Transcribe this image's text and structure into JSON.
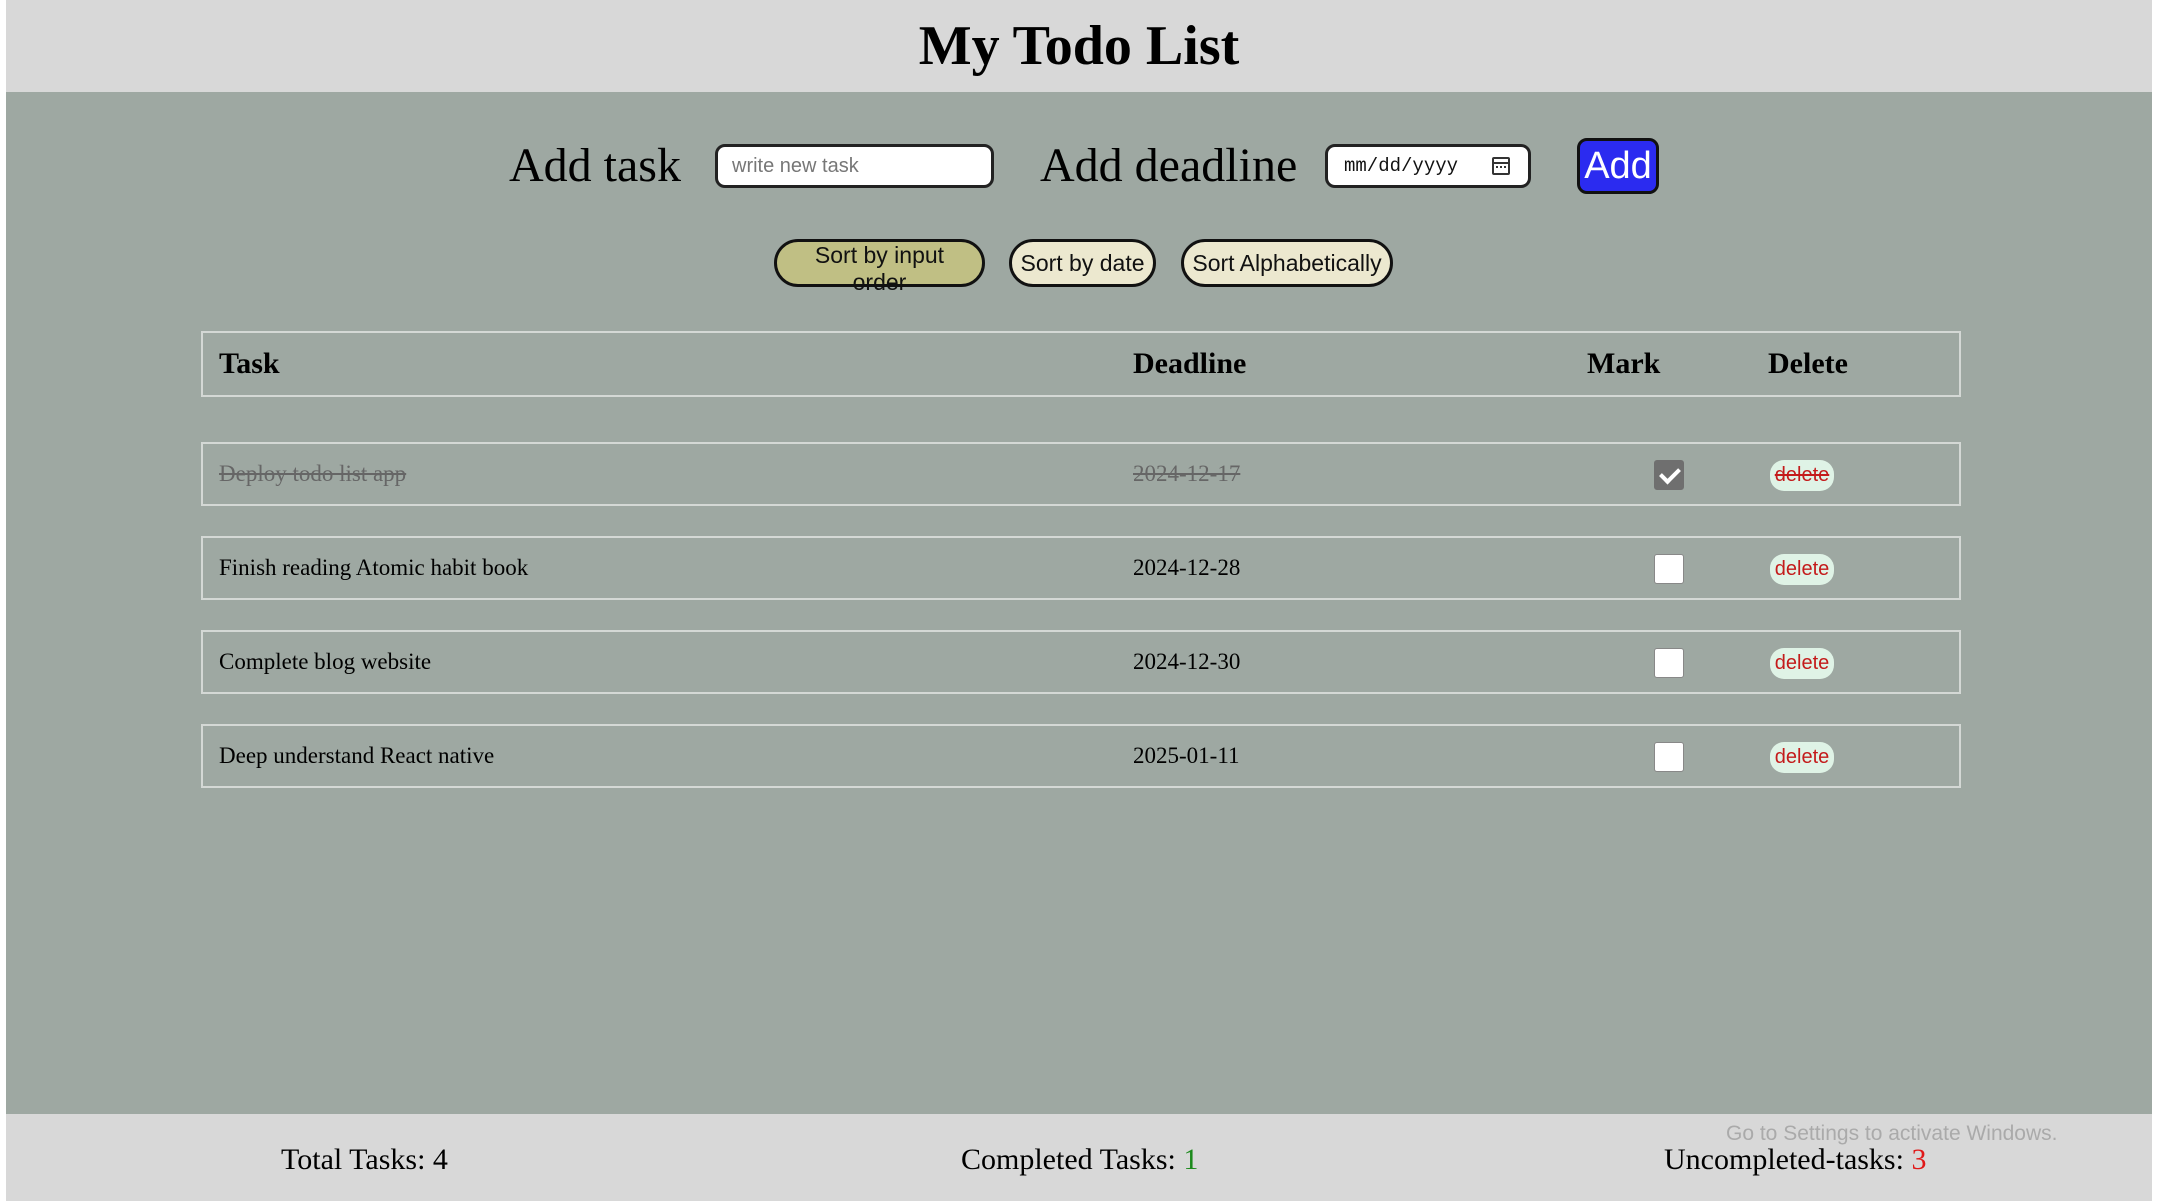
{
  "header": {
    "title": "My Todo List"
  },
  "add_form": {
    "task_label": "Add task",
    "task_placeholder": "write new task",
    "deadline_label": "Add deadline",
    "date_placeholder": "mm/dd/yyyy",
    "add_button": "Add"
  },
  "sort": {
    "input_order": "Sort by input order",
    "by_date": "Sort by date",
    "alphabetical": "Sort Alphabetically",
    "active": "input_order"
  },
  "table": {
    "headers": {
      "task": "Task",
      "deadline": "Deadline",
      "mark": "Mark",
      "delete": "Delete"
    },
    "rows": [
      {
        "task": "Deploy todo list app",
        "deadline": "2024-12-17",
        "completed": true,
        "delete_label": "delete"
      },
      {
        "task": "Finish reading Atomic habit book",
        "deadline": "2024-12-28",
        "completed": false,
        "delete_label": "delete"
      },
      {
        "task": "Complete blog website",
        "deadline": "2024-12-30",
        "completed": false,
        "delete_label": "delete"
      },
      {
        "task": "Deep understand React native",
        "deadline": "2025-01-11",
        "completed": false,
        "delete_label": "delete"
      }
    ]
  },
  "footer": {
    "total_label": "Total Tasks: ",
    "total": "4",
    "completed_label": "Completed Tasks: ",
    "completed": "1",
    "uncompleted_label": "Uncompleted-tasks: ",
    "uncompleted": "3",
    "watermark": "Go to Settings to activate Windows."
  },
  "colors": {
    "background": "#9ea8a2",
    "header_bg": "#d8d8d8",
    "add_button": "#2b2bf0",
    "sort_active": "#c0bf84",
    "sort_inactive": "#ece8cf",
    "delete_text": "#c41b1b",
    "completed_count": "#1c8a1c",
    "uncompleted_count": "#e01818"
  }
}
